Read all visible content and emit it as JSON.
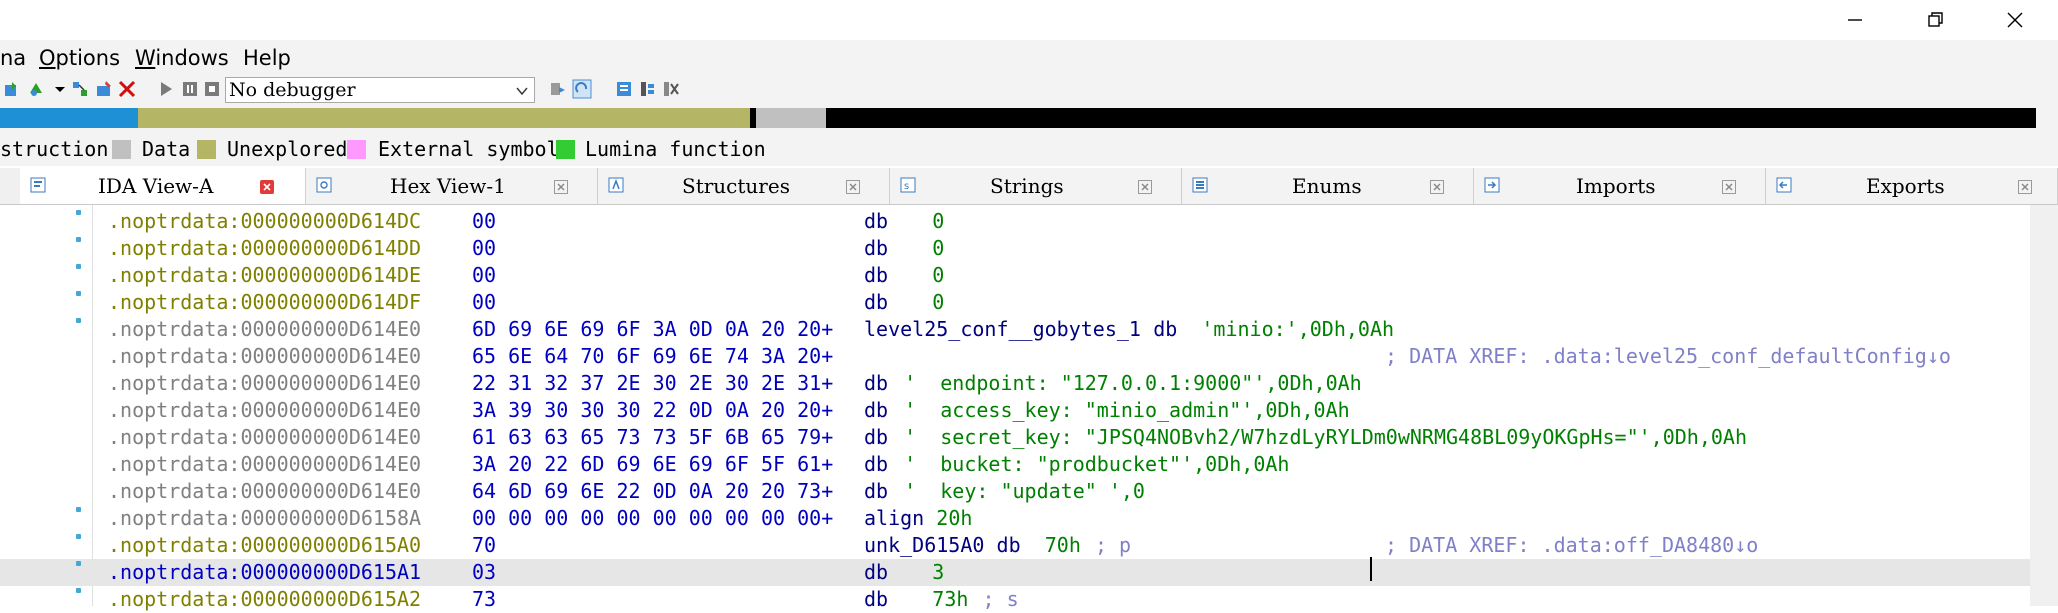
{
  "menubar": {
    "items": [
      {
        "pre": "",
        "under": "",
        "post": "na"
      },
      {
        "pre": "",
        "under": "O",
        "post": "ptions"
      },
      {
        "pre": "",
        "under": "W",
        "post": "indows"
      },
      {
        "pre": "",
        "under": "",
        "post": "Help"
      }
    ]
  },
  "toolbar": {
    "debugger_value": "No debugger"
  },
  "legend": {
    "items": [
      {
        "label": "struction",
        "color": ""
      },
      {
        "label": "Data",
        "color": "#c0c0c0"
      },
      {
        "label": "Unexplored",
        "color": "#b5b566"
      },
      {
        "label": "External symbol",
        "color": "#ff99ff"
      },
      {
        "label": "Lumina function",
        "color": "#33cc33"
      }
    ]
  },
  "colors": {
    "code": "#1e90d6",
    "unexplored": "#b5b566",
    "data": "#c0c0c0",
    "black": "#000000"
  },
  "tabs": [
    {
      "label": "IDA View-A",
      "icon": "ida-view-icon",
      "active": true
    },
    {
      "label": "Hex View-1",
      "icon": "hex-view-icon",
      "active": false
    },
    {
      "label": "Structures",
      "icon": "structures-icon",
      "active": false
    },
    {
      "label": "Strings",
      "icon": "strings-icon",
      "active": false
    },
    {
      "label": "Enums",
      "icon": "enums-icon",
      "active": false
    },
    {
      "label": "Imports",
      "icon": "imports-icon",
      "active": false
    },
    {
      "label": "Exports",
      "icon": "exports-icon",
      "active": false
    }
  ],
  "listing": {
    "rows": [
      {
        "addr": ".noptrdata:000000000D614DC",
        "bytes": "00",
        "label": "",
        "mnem": "db",
        "operand": "0",
        "comment": "",
        "addr_style": "olive",
        "dot": true
      },
      {
        "addr": ".noptrdata:000000000D614DD",
        "bytes": "00",
        "label": "",
        "mnem": "db",
        "operand": "0",
        "comment": "",
        "addr_style": "olive",
        "dot": true
      },
      {
        "addr": ".noptrdata:000000000D614DE",
        "bytes": "00",
        "label": "",
        "mnem": "db",
        "operand": "0",
        "comment": "",
        "addr_style": "olive",
        "dot": true
      },
      {
        "addr": ".noptrdata:000000000D614DF",
        "bytes": "00",
        "label": "",
        "mnem": "db",
        "operand": "0",
        "comment": "",
        "addr_style": "olive",
        "dot": true
      },
      {
        "addr": ".noptrdata:000000000D614E0",
        "bytes": "6D 69 6E 69 6F 3A 0D 0A 20 20+",
        "label": "level25_conf__gobytes_1",
        "mnem": "db",
        "operand": "'minio:',0Dh,0Ah",
        "comment": "",
        "addr_style": "grey",
        "dot": true
      },
      {
        "addr": ".noptrdata:000000000D614E0",
        "bytes": "65 6E 64 70 6F 69 6E 74 3A 20+",
        "label": "",
        "mnem": "",
        "operand": "",
        "comment": "; DATA XREF: .data:level25_conf_defaultConfig↓o",
        "addr_style": "grey",
        "dot": false
      },
      {
        "addr": ".noptrdata:000000000D614E0",
        "bytes": "22 31 32 37 2E 30 2E 30 2E 31+",
        "label": "",
        "mnem": "db",
        "operand": "'  endpoint: \"127.0.0.1:9000\"',0Dh,0Ah",
        "comment": "",
        "addr_style": "grey",
        "dot": false
      },
      {
        "addr": ".noptrdata:000000000D614E0",
        "bytes": "3A 39 30 30 30 22 0D 0A 20 20+",
        "label": "",
        "mnem": "db",
        "operand": "'  access_key: \"minio_admin\"',0Dh,0Ah",
        "comment": "",
        "addr_style": "grey",
        "dot": false
      },
      {
        "addr": ".noptrdata:000000000D614E0",
        "bytes": "61 63 63 65 73 73 5F 6B 65 79+",
        "label": "",
        "mnem": "db",
        "operand": "'  secret_key: \"JPSQ4NOBvh2/W7hzdLyRYLDm0wNRMG48BL09yOKGpHs=\"',0Dh,0Ah",
        "comment": "",
        "addr_style": "grey",
        "dot": false
      },
      {
        "addr": ".noptrdata:000000000D614E0",
        "bytes": "3A 20 22 6D 69 6E 69 6F 5F 61+",
        "label": "",
        "mnem": "db",
        "operand": "'  bucket: \"prodbucket\"',0Dh,0Ah",
        "comment": "",
        "addr_style": "grey",
        "dot": false
      },
      {
        "addr": ".noptrdata:000000000D614E0",
        "bytes": "64 6D 69 6E 22 0D 0A 20 20 73+",
        "label": "",
        "mnem": "db",
        "operand": "'  key: \"update\" ',0",
        "comment": "",
        "addr_style": "grey",
        "dot": false
      },
      {
        "addr": ".noptrdata:000000000D6158A",
        "bytes": "00 00 00 00 00 00 00 00 00 00+",
        "label": "",
        "mnem": "align",
        "operand": "20h",
        "comment": "",
        "addr_style": "grey",
        "dot": true
      },
      {
        "addr": ".noptrdata:000000000D615A0",
        "bytes": "70",
        "label": "unk_D615A0",
        "mnem": "db",
        "operand": "70h",
        "comment2": "; p",
        "comment": "; DATA XREF: .data:off_DA8480↓o",
        "addr_style": "olive",
        "dot": true
      },
      {
        "addr": ".noptrdata:000000000D615A1",
        "bytes": "03",
        "label": "",
        "mnem": "db",
        "operand": "3",
        "comment": "",
        "addr_style": "blue",
        "dot": true,
        "selected": true
      },
      {
        "addr": ".noptrdata:000000000D615A2",
        "bytes": "73",
        "label": "",
        "mnem": "db",
        "operand": "73h",
        "comment2": "; s",
        "comment": "",
        "addr_style": "olive",
        "dot": true
      }
    ]
  }
}
